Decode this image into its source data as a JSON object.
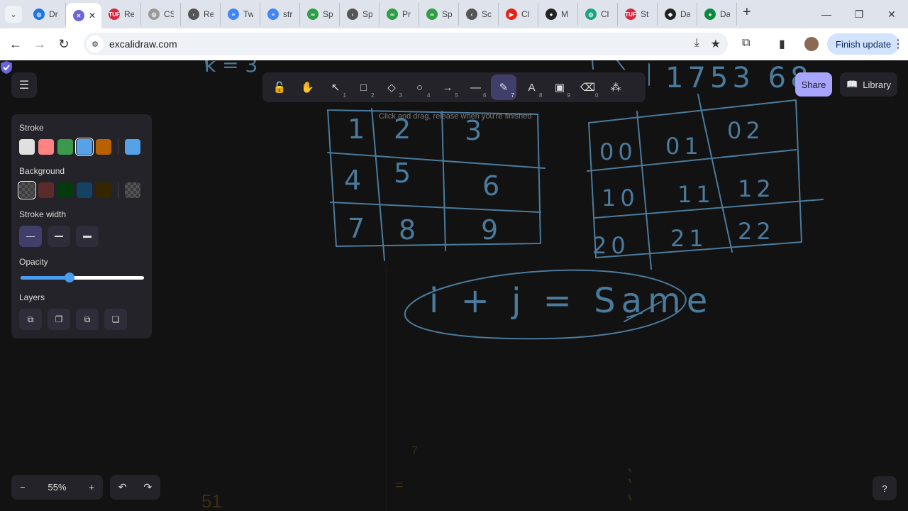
{
  "browser": {
    "tabs": [
      {
        "title": "Dr",
        "color": "#1a73e8",
        "glyph": "◎"
      },
      {
        "title": "",
        "color": "#6965db",
        "glyph": "✕",
        "active": true
      },
      {
        "title": "Re",
        "color": "#d9243a",
        "glyph": "TUF"
      },
      {
        "title": "CS",
        "color": "#999999",
        "glyph": "◎"
      },
      {
        "title": "Re",
        "color": "#555555",
        "glyph": "‹"
      },
      {
        "title": "Tw",
        "color": "#4285f4",
        "glyph": "≡"
      },
      {
        "title": "str",
        "color": "#4285f4",
        "glyph": "≡"
      },
      {
        "title": "Sp",
        "color": "#2e9e46",
        "glyph": "∞"
      },
      {
        "title": "Sp",
        "color": "#555555",
        "glyph": "‹"
      },
      {
        "title": "Pr",
        "color": "#2e9e46",
        "glyph": "∞"
      },
      {
        "title": "Sp",
        "color": "#2e9e46",
        "glyph": "∞"
      },
      {
        "title": "Sc",
        "color": "#555555",
        "glyph": "‹"
      },
      {
        "title": "Cl",
        "color": "#e62117",
        "glyph": "▶"
      },
      {
        "title": "M",
        "color": "#222222",
        "glyph": "●"
      },
      {
        "title": "Cl",
        "color": "#19a37f",
        "glyph": "◎"
      },
      {
        "title": "St",
        "color": "#d9243a",
        "glyph": "TUF"
      },
      {
        "title": "Da",
        "color": "#222222",
        "glyph": "◆"
      },
      {
        "title": "Da",
        "color": "#0b8a3e",
        "glyph": "●"
      }
    ],
    "url": "excalidraw.com",
    "finish_update": "Finish update"
  },
  "toolbar": {
    "tools": [
      {
        "name": "lock",
        "glyph": "🔓",
        "key": ""
      },
      {
        "name": "hand",
        "glyph": "✋",
        "key": ""
      },
      {
        "name": "selection",
        "glyph": "↖",
        "key": "1"
      },
      {
        "name": "rectangle",
        "glyph": "□",
        "key": "2"
      },
      {
        "name": "diamond",
        "glyph": "◇",
        "key": "3"
      },
      {
        "name": "ellipse",
        "glyph": "○",
        "key": "4"
      },
      {
        "name": "arrow",
        "glyph": "→",
        "key": "5"
      },
      {
        "name": "line",
        "glyph": "—",
        "key": "6"
      },
      {
        "name": "draw",
        "glyph": "✎",
        "key": "7",
        "active": true
      },
      {
        "name": "text",
        "glyph": "A",
        "key": "8"
      },
      {
        "name": "image",
        "glyph": "▣",
        "key": "9"
      },
      {
        "name": "eraser",
        "glyph": "⌫",
        "key": "0"
      },
      {
        "name": "extra-tools",
        "glyph": "⁂",
        "key": ""
      }
    ],
    "hint": "Click and drag, release when you're finished"
  },
  "share_label": "Share",
  "library_label": "Library",
  "props": {
    "stroke_label": "Stroke",
    "stroke_colors": [
      "#e0e0e0",
      "#ff8383",
      "#3a994c",
      "#56a2e8",
      "#b76100"
    ],
    "stroke_selected": "#56a2e8",
    "background_label": "Background",
    "background_colors": [
      "transparent",
      "#5b2c2c",
      "#043b0c",
      "#154163",
      "#362600"
    ],
    "stroke_width_label": "Stroke width",
    "opacity_label": "Opacity",
    "opacity": 0.4,
    "layers_label": "Layers"
  },
  "zoom": {
    "value": "55%",
    "minus": "−",
    "plus": "+"
  },
  "drawing_color": "#4a7b9d",
  "left_grid_digits": [
    "1",
    "2",
    "3",
    "4",
    "5",
    "6",
    "7",
    "8",
    "9"
  ],
  "right_grid_indices": [
    "00",
    "01",
    "02",
    "10",
    "11",
    "12",
    "20",
    "21",
    "22"
  ],
  "equation": "i + j = Same",
  "top_sequence": "1753 68",
  "top_left_fragment": "k = 3",
  "bottom_marks": [
    "7",
    "=",
    "51"
  ]
}
